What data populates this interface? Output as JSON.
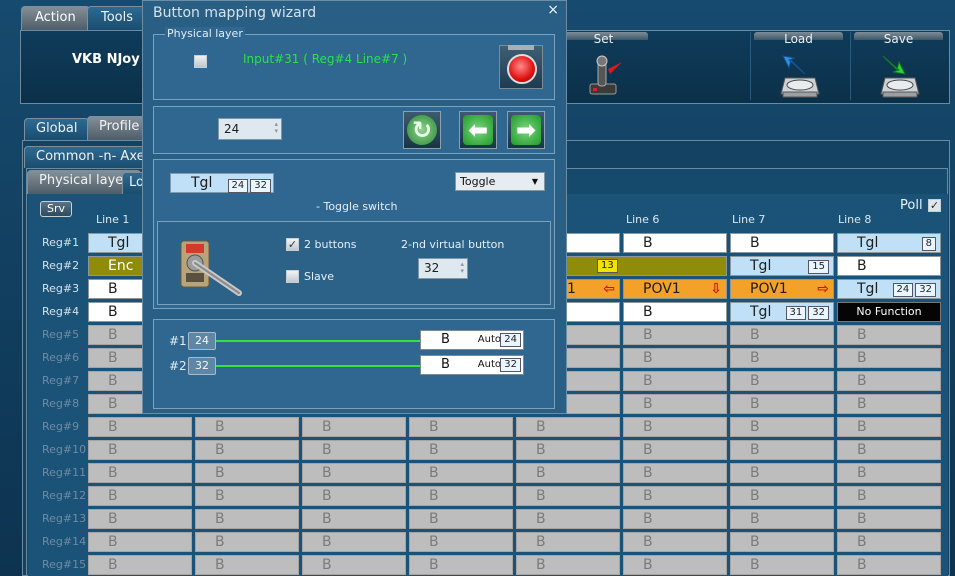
{
  "main": {
    "top_tabs": [
      "Action",
      "Tools"
    ],
    "device_name": "VKB NJoy",
    "tools": [
      {
        "label": "Set",
        "icon": "joystick-set-icon"
      },
      {
        "label": "Load",
        "icon": "disk-load-icon"
      },
      {
        "label": "Save",
        "icon": "disk-save-icon"
      }
    ],
    "profile_tabs": [
      "Global",
      "Profile"
    ],
    "section_tab": "Common -n- Axes",
    "layer_tabs": [
      "Physical layer",
      "Lo"
    ],
    "srv_label": "Srv",
    "poll_label": "Poll",
    "poll_checked": "✓",
    "col_headers": [
      "Line 1",
      "Line 6",
      "Line 7",
      "Line 8"
    ],
    "row_headers": [
      "Reg#1",
      "Reg#2",
      "Reg#3",
      "Reg#4",
      "Reg#5",
      "Reg#6",
      "Reg#7",
      "Reg#8",
      "Reg#9",
      "Reg#10",
      "Reg#11",
      "Reg#12",
      "Reg#13",
      "Reg#14",
      "Reg#15"
    ],
    "cells": {
      "r1c1": "Tgl",
      "r1c6": "B",
      "r1c7": "B",
      "r1c8": "Tgl",
      "r1c8_badge": "8",
      "r2c1": "Enc",
      "r2c5_badge": "13",
      "r2c7": "Tgl",
      "r2c7_badge": "15",
      "r2c8": "B",
      "r3c1": "B",
      "r3c5": "1",
      "r3c6": "POV1",
      "r3c7": "POV1",
      "r3c8": "Tgl",
      "r3c8_b1": "24",
      "r3c8_b2": "32",
      "r4c1": "B",
      "r4c6": "B",
      "r4c7": "Tgl",
      "r4c7_b1": "31",
      "r4c7_b2": "32",
      "r4c8": "No Function",
      "empty": "B"
    }
  },
  "wizard": {
    "title": "Button mapping wizard",
    "close": "×",
    "physical_legend": "Physical layer",
    "input_text": "Input#31  ( Reg#4  Line#7 )",
    "button_number": "24",
    "mapping_label": "Tgl",
    "mapping_b1": "24",
    "mapping_b2": "32",
    "type_selected": "Toggle",
    "type_desc": "- Toggle switch",
    "two_buttons_label": "2 buttons",
    "two_buttons_checked": "✓",
    "slave_label": "Slave",
    "second_virtual_label": "2-nd virtual button",
    "second_virtual_value": "32",
    "map": [
      {
        "label": "#1",
        "source": "24",
        "target": "B",
        "mode": "Auto",
        "value": "24"
      },
      {
        "label": "#2",
        "source": "32",
        "target": "B",
        "mode": "Auto",
        "value": "32"
      }
    ]
  }
}
